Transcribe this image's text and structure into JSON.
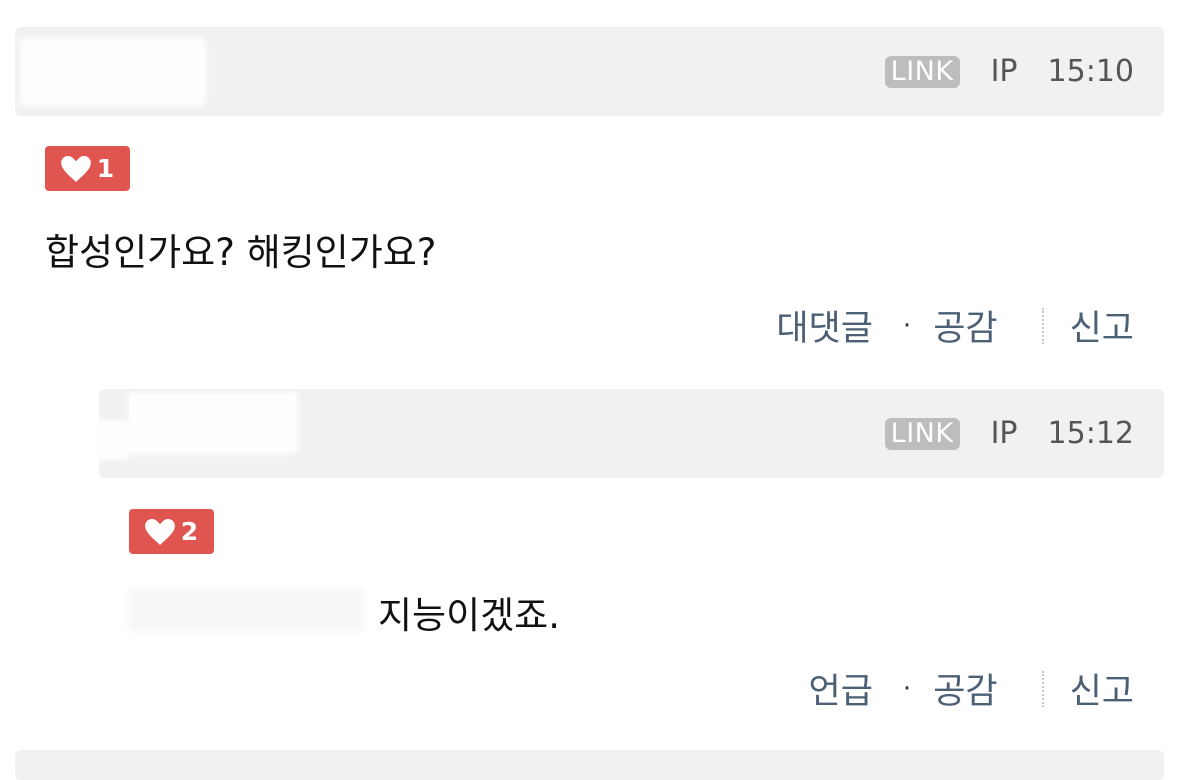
{
  "comments": [
    {
      "badge": "LINK",
      "ip": "IP",
      "time": "15:10",
      "likes": "1",
      "text": "합성인가요? 해킹인가요?",
      "actions": {
        "reply": "대댓글",
        "dot": "·",
        "empathy": "공감",
        "report": "신고"
      }
    },
    {
      "badge": "LINK",
      "ip": "IP",
      "time": "15:12",
      "likes": "2",
      "text": "지능이겠죠.",
      "actions": {
        "reply": "언급",
        "dot": "·",
        "empathy": "공감",
        "report": "신고"
      }
    }
  ],
  "colors": {
    "like_badge": "#e0554f",
    "header_bg": "#f1f1f1",
    "link_badge": "#bdbdbd",
    "action_text": "#4b6075"
  },
  "icons": {
    "like": "heart-icon"
  }
}
